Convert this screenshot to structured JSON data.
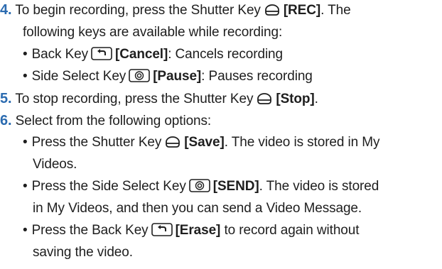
{
  "steps": [
    {
      "number": "4.",
      "text_before_key": "To begin recording, press the Shutter Key",
      "key_icon": "shutter-key-icon",
      "key_label": "[REC]",
      "text_after_key": ". The",
      "continuation": "following keys are available while recording:",
      "bullets": [
        {
          "symbol": "•",
          "text_before_key": "Back Key",
          "key_icon": "back-key-icon",
          "key_label": "[Cancel]",
          "text_after_key": ": Cancels recording"
        },
        {
          "symbol": "•",
          "text_before_key": "Side Select Key",
          "key_icon": "side-select-key-icon",
          "key_label": "[Pause]",
          "text_after_key": ": Pauses recording"
        }
      ]
    },
    {
      "number": "5.",
      "text_before_key": "To stop recording, press the Shutter Key",
      "key_icon": "shutter-key-icon",
      "key_label": "[Stop]",
      "text_after_key": "."
    },
    {
      "number": "6.",
      "text": "Select from the following options:",
      "bullets": [
        {
          "symbol": "•",
          "text_before_key": "Press the Shutter Key",
          "key_icon": "shutter-key-icon",
          "key_label": "[Save]",
          "text_after_key": ". The video is stored in My",
          "continuation": "Videos."
        },
        {
          "symbol": "•",
          "text_before_key": "Press the Side Select Key",
          "key_icon": "side-select-key-icon",
          "key_label": "[SEND]",
          "text_after_key": ". The video is stored",
          "continuation": "in My Videos, and then you can send a Video Message."
        },
        {
          "symbol": "•",
          "text_before_key": "Press the Back Key",
          "key_icon": "back-key-icon",
          "key_label": "[Erase]",
          "text_after_key": " to record again without",
          "continuation": "saving the video."
        }
      ]
    }
  ],
  "colors": {
    "step_number": "#2b6bb0",
    "text": "#1e1e1e"
  }
}
